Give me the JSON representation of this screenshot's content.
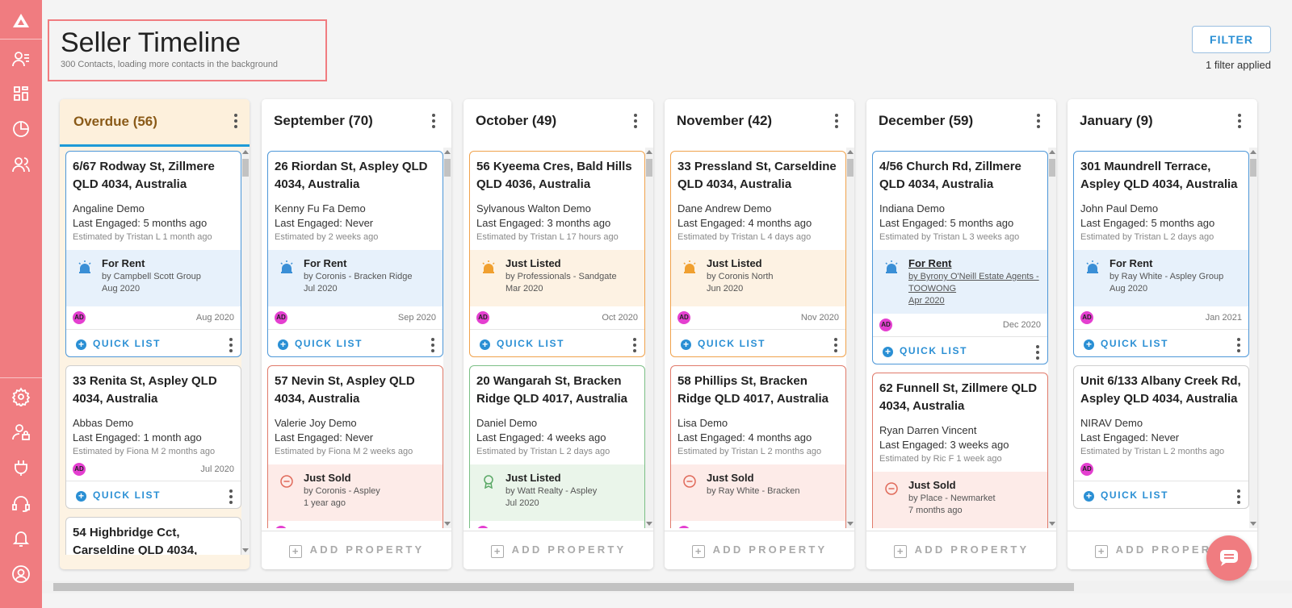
{
  "header": {
    "title": "Seller Timeline",
    "subtitle": "300 Contacts, loading more contacts in the background",
    "filter_label": "FILTER",
    "filter_applied": "1 filter applied"
  },
  "sidebar": {
    "items": [
      {
        "icon": "logo-icon"
      },
      {
        "icon": "contacts-list-icon"
      },
      {
        "icon": "dashboard-icon"
      },
      {
        "icon": "pie-chart-icon"
      },
      {
        "icon": "people-icon"
      },
      {
        "icon": "settings-icon"
      },
      {
        "icon": "user-lock-icon"
      },
      {
        "icon": "plug-icon"
      },
      {
        "icon": "headset-icon"
      },
      {
        "icon": "bell-icon"
      },
      {
        "icon": "account-icon"
      }
    ]
  },
  "common": {
    "quick_list": "QUICK LIST",
    "add_property": "ADD PROPERTY",
    "avatar": "AD"
  },
  "columns": [
    {
      "title": "Overdue (56)",
      "cards": [
        {
          "address": "6/67 Rodway St, Zillmere QLD 4034, Australia",
          "contact": "Angaline Demo",
          "engaged": "Last Engaged: 5 months ago",
          "estimated": "Estimated by Tristan L 1 month ago",
          "status": {
            "type": "blue",
            "icon": "alarm-icon",
            "title": "For Rent",
            "by": "by Campbell Scott Group",
            "date": "Aug 2020"
          },
          "date": "Aug 2020"
        },
        {
          "address": "33 Renita St, Aspley QLD 4034, Australia",
          "contact": "Abbas Demo",
          "engaged": "Last Engaged: 1 month ago",
          "estimated": "Estimated by Fiona M 2 months ago",
          "status": null,
          "date": "Jul 2020"
        },
        {
          "address": "54 Highbridge Cct, Carseldine QLD 4034,",
          "contact": "",
          "engaged": "",
          "estimated": "",
          "status": null,
          "date": ""
        }
      ]
    },
    {
      "title": "September (70)",
      "cards": [
        {
          "address": "26 Riordan St, Aspley QLD 4034, Australia",
          "contact": "Kenny Fu Fa Demo",
          "engaged": "Last Engaged: Never",
          "estimated": "Estimated by 2 weeks ago",
          "status": {
            "type": "blue",
            "icon": "alarm-icon",
            "title": "For Rent",
            "by": "by Coronis - Bracken Ridge",
            "date": "Jul 2020"
          },
          "date": "Sep 2020"
        },
        {
          "address": "57 Nevin St, Aspley QLD 4034, Australia",
          "contact": "Valerie Joy Demo",
          "engaged": "Last Engaged: Never",
          "estimated": "Estimated by Fiona M 2 weeks ago",
          "status": {
            "type": "red",
            "icon": "minus-circle-icon",
            "title": "Just Sold",
            "by": "by Coronis - Aspley",
            "date": "1 year ago"
          },
          "date": ""
        }
      ]
    },
    {
      "title": "October (49)",
      "cards": [
        {
          "address": "56 Kyeema Cres, Bald Hills QLD 4036, Australia",
          "contact": "Sylvanous Walton Demo",
          "engaged": "Last Engaged: 3 months ago",
          "estimated": "Estimated by Tristan L 17 hours ago",
          "status": {
            "type": "orange",
            "icon": "alarm-icon",
            "title": "Just Listed",
            "by": "by Professionals - Sandgate",
            "date": "Mar 2020"
          },
          "date": "Oct 2020"
        },
        {
          "address": "20 Wangarah St, Bracken Ridge QLD 4017, Australia",
          "contact": "Daniel Demo",
          "engaged": "Last Engaged: 4 weeks ago",
          "estimated": "Estimated by Tristan L 2 days ago",
          "status": {
            "type": "green",
            "icon": "award-icon",
            "title": "Just Listed",
            "by": "by Watt Realty - Aspley",
            "date": "Jul 2020"
          },
          "date": ""
        }
      ]
    },
    {
      "title": "November (42)",
      "cards": [
        {
          "address": "33 Pressland St, Carseldine QLD 4034, Australia",
          "contact": "Dane Andrew Demo",
          "engaged": "Last Engaged: 4 months ago",
          "estimated": "Estimated by Tristan L 4 days ago",
          "status": {
            "type": "orange",
            "icon": "alarm-icon",
            "title": "Just Listed",
            "by": "by Coronis North",
            "date": "Jun 2020"
          },
          "date": "Nov 2020"
        },
        {
          "address": "58 Phillips St, Bracken Ridge QLD 4017, Australia",
          "contact": "Lisa Demo",
          "engaged": "Last Engaged: 4 months ago",
          "estimated": "Estimated by Tristan L 2 months ago",
          "status": {
            "type": "red",
            "icon": "minus-circle-icon",
            "title": "Just Sold",
            "by": "by Ray White - Bracken",
            "date": ""
          },
          "date": ""
        }
      ]
    },
    {
      "title": "December (59)",
      "cards": [
        {
          "address": "4/56 Church Rd, Zillmere QLD 4034, Australia",
          "contact": "Indiana Demo",
          "engaged": "Last Engaged: 5 months ago",
          "estimated": "Estimated by Tristan L 3 weeks ago",
          "status": {
            "type": "blue",
            "icon": "alarm-icon",
            "title": "For Rent",
            "by": "by Byrony O'Neill Estate Agents - TOOWONG",
            "date": "Apr 2020",
            "link": true
          },
          "date": "Dec 2020"
        },
        {
          "address": "62 Funnell St, Zillmere QLD 4034, Australia",
          "contact": "Ryan Darren Vincent",
          "engaged": "Last Engaged: 3 weeks ago",
          "estimated": "Estimated by Ric F 1 week ago",
          "status": {
            "type": "red",
            "icon": "minus-circle-icon",
            "title": "Just Sold",
            "by": "by Place - Newmarket",
            "date": "7 months ago"
          },
          "date": ""
        }
      ]
    },
    {
      "title": "January (9)",
      "cards": [
        {
          "address": "301 Maundrell Terrace, Aspley QLD 4034, Australia",
          "contact": "John Paul Demo",
          "engaged": "Last Engaged: 5 months ago",
          "estimated": "Estimated by Tristan L 2 days ago",
          "status": {
            "type": "blue",
            "icon": "alarm-icon",
            "title": "For Rent",
            "by": "by Ray White - Aspley Group",
            "date": "Aug 2020"
          },
          "date": "Jan 2021"
        },
        {
          "address": "Unit 6/133 Albany Creek Rd, Aspley QLD 4034, Australia",
          "contact": "NIRAV Demo",
          "engaged": "Last Engaged: Never",
          "estimated": "Estimated by Tristan L 2 months ago",
          "status": null,
          "date": ""
        }
      ]
    }
  ],
  "colors": {
    "sidebar": "#f07c80",
    "accent": "#2a8fd4",
    "overdue_bg": "#fdf0dc",
    "avatar": "#e43fd0"
  }
}
